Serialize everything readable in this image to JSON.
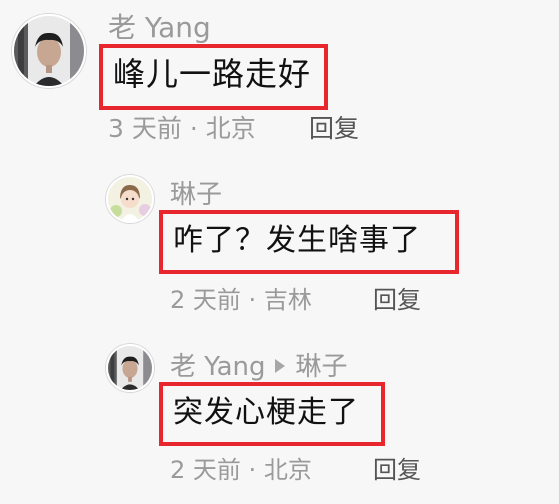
{
  "comments": [
    {
      "username": "老 Yang",
      "text": "峰儿一路走好",
      "time": "3 天前",
      "location": "北京",
      "reply_label": "回复"
    },
    {
      "username": "琳子",
      "text": "咋了？发生啥事了",
      "time": "2 天前",
      "location": "吉林",
      "reply_label": "回复"
    },
    {
      "username": "老 Yang",
      "reply_to": "琳子",
      "text": "突发心梗走了",
      "time": "2 天前",
      "location": "北京",
      "reply_label": "回复"
    }
  ],
  "meta_separator": "·",
  "colors": {
    "highlight": "#e8262d",
    "meta_text": "#9a9a9a",
    "body_text": "#111111",
    "background": "#f7f7f8"
  }
}
